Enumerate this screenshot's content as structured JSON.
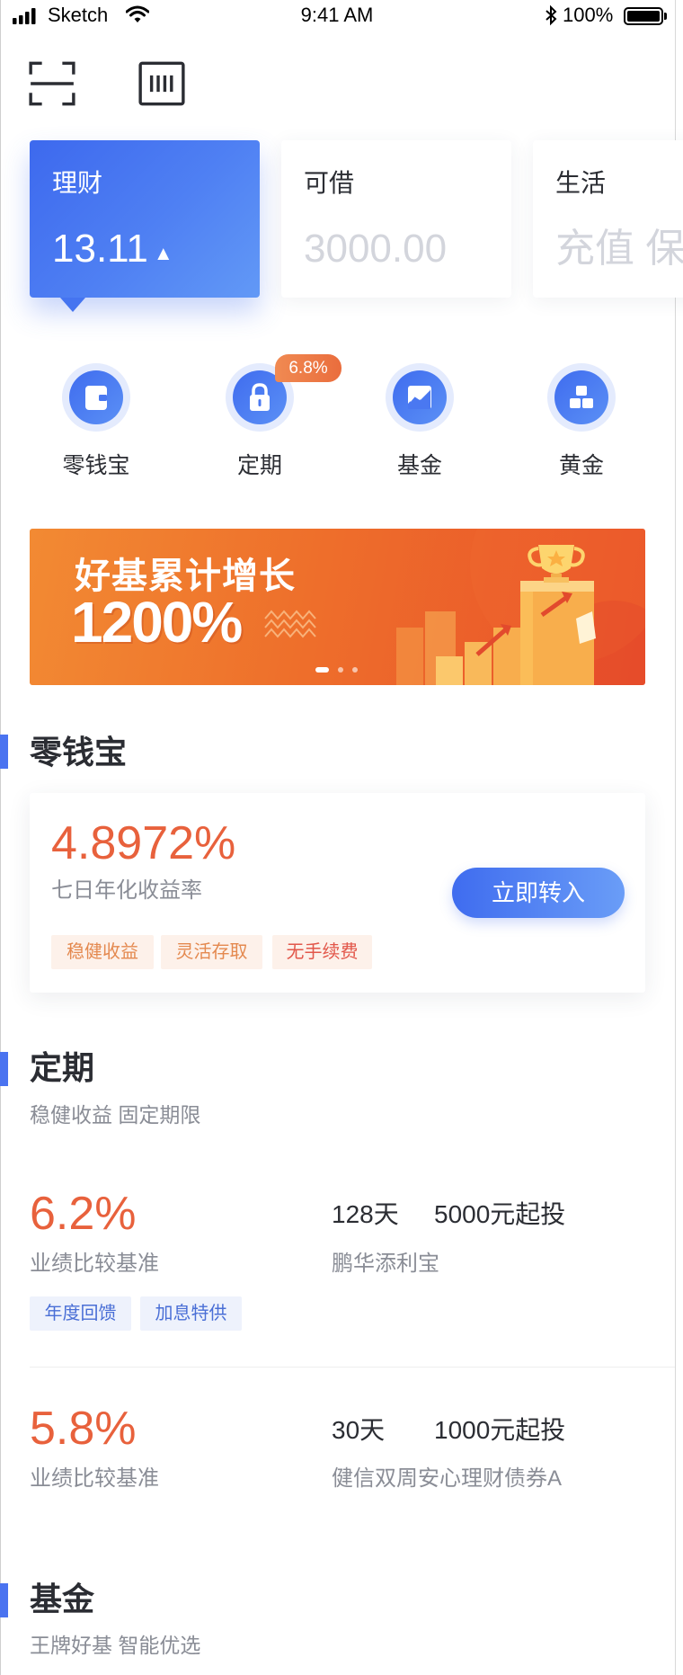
{
  "status_bar": {
    "carrier": "Sketch",
    "time": "9:41 AM",
    "battery": "100%"
  },
  "toolbar": {
    "left_icon": "scan-icon",
    "right_icon": "barcode-icon"
  },
  "accounts": [
    {
      "title": "理财",
      "value": "13.11",
      "trend": "▲",
      "active": true
    },
    {
      "title": "可借",
      "value": "3000.00",
      "active": false
    },
    {
      "title": "生活",
      "value": "充值 保险",
      "active": false
    }
  ],
  "quick_nav": [
    {
      "label": "零钱宝",
      "icon": "wallet-icon"
    },
    {
      "label": "定期",
      "icon": "lock-icon",
      "badge": "6.8%"
    },
    {
      "label": "基金",
      "icon": "trend-chart-icon"
    },
    {
      "label": "黄金",
      "icon": "gold-bars-icon"
    }
  ],
  "banner": {
    "headline": "好基累计增长",
    "figure": "1200%",
    "slide_count": 3,
    "active_slide": 1
  },
  "lingqianbao": {
    "title": "零钱宝",
    "rate": "4.8972%",
    "rate_label": "七日年化收益率",
    "cta": "立即转入",
    "tags": [
      "稳健收益",
      "灵活存取",
      "无手续费"
    ]
  },
  "dingqi": {
    "title": "定期",
    "subtitle": "稳健收益 固定期限",
    "products": [
      {
        "rate": "6.2%",
        "rate_label": "业绩比较基准",
        "term": "128天",
        "min_invest": "5000元起投",
        "name": "鹏华添利宝",
        "tags": [
          "年度回馈",
          "加息特供"
        ]
      },
      {
        "rate": "5.8%",
        "rate_label": "业绩比较基准",
        "term": "30天",
        "min_invest": "1000元起投",
        "name": "健信双周安心理财债券A",
        "tags": []
      }
    ]
  },
  "jijin": {
    "title": "基金",
    "subtitle": "王牌好基 智能优选"
  },
  "colors": {
    "accent": "#4A73F0",
    "highlight": "#E8613C",
    "banner": "#EE6F2B",
    "tag_orange": "#E4894F",
    "tag_blue": "#4A6FD6"
  }
}
